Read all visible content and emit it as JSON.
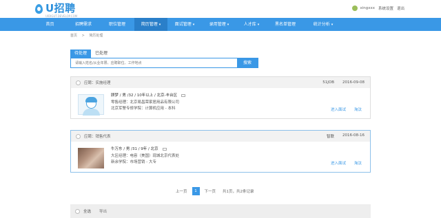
{
  "header": {
    "logo_text": "U招聘",
    "logo_sub": "UIDIGUT.DEVELOP.COM",
    "username": "xingxxx",
    "settings_label": "系统设置",
    "logout_label": "退出"
  },
  "nav": [
    {
      "label": "首页",
      "caret": ""
    },
    {
      "label": "招聘需求",
      "caret": ""
    },
    {
      "label": "职位管理",
      "caret": ""
    },
    {
      "label": "简历管理",
      "caret": "▾"
    },
    {
      "label": "面试管理",
      "caret": "▾"
    },
    {
      "label": "录用管理",
      "caret": "▾"
    },
    {
      "label": "人才库",
      "caret": "▾"
    },
    {
      "label": "黑名单管理",
      "caret": ""
    },
    {
      "label": "统计分析",
      "caret": "▾"
    }
  ],
  "breadcrumb": {
    "home": "首页",
    "sep": ">",
    "current": "简历处理"
  },
  "tabs": {
    "pending": "待处理",
    "processed": "已处理"
  },
  "search": {
    "placeholder": "请输入姓名/从业年限、应聘职位、工作地点",
    "button": "搜索"
  },
  "candidates": [
    {
      "position": "应聘：实施经理",
      "source": "51JOB",
      "date": "2016-09-08",
      "main": "顾梦 / 男 /32 / 10年以上 / 北京-丰台区",
      "job": "零售经理：北京易昌荣家居用品有限公司",
      "edu": "北京军警专修学院：计算机应用 - 本科",
      "action1": "进入面试",
      "action2": "淘汰"
    },
    {
      "position": "应聘：销售代表",
      "source": "智联",
      "date": "2016-08-16",
      "main": "牛万东 / 男 /31 / 9年 / 北京",
      "job": "大区经理：电容（美国）现城北京代表处",
      "edu": "新余学院：市场营销 - 大专",
      "action1": "进入面试",
      "action2": "淘汰"
    }
  ],
  "pager": {
    "prev": "上一页",
    "current": "1",
    "next": "下一页",
    "summary": "共1页，共2条记录"
  },
  "footer": {
    "select_all": "全选",
    "export": "导出"
  },
  "colors": {
    "accent": "#3a98e6",
    "nav_active": "#2a7fc9"
  }
}
